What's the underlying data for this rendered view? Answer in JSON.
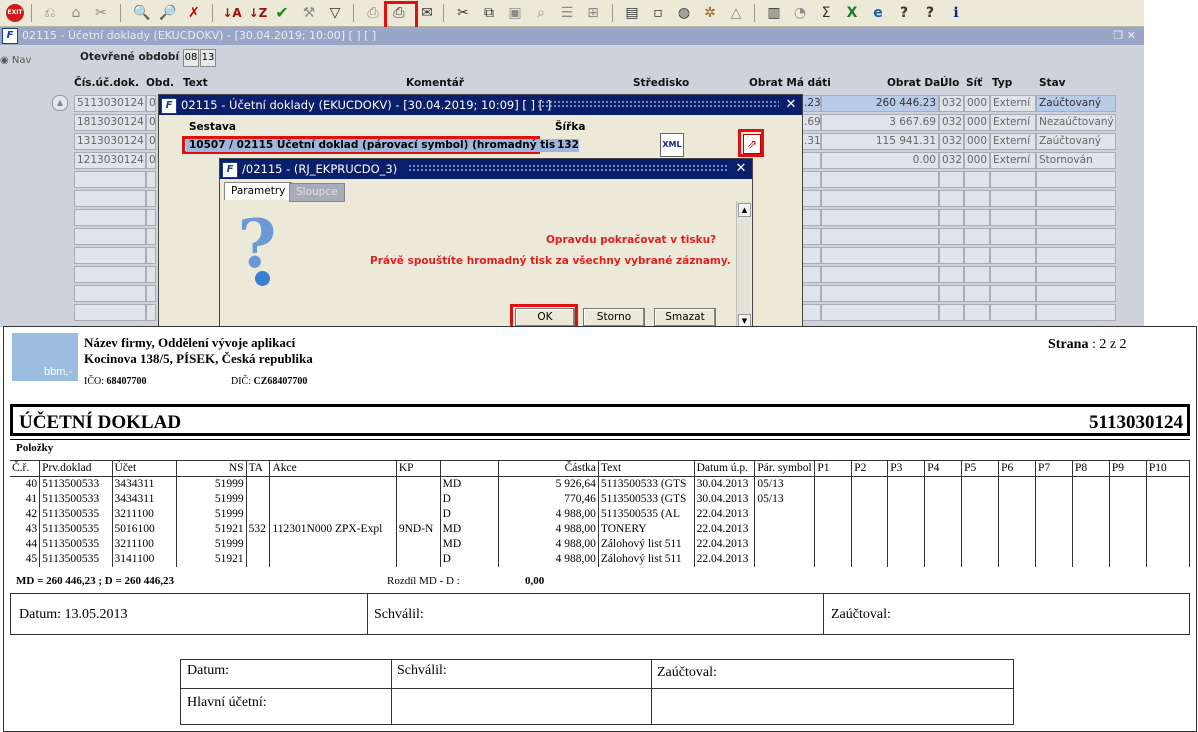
{
  "toolbar": {
    "exit_label": "EXIT",
    "icons": [
      "exit-icon",
      "filter-add-icon",
      "home-icon",
      "tools-icon",
      "tools-x-icon",
      "search-doc-icon",
      "search-doc2-icon",
      "delete-doc-icon",
      "sort-asc-icon",
      "sort-desc-icon",
      "check-icon",
      "wrench-icon",
      "filter-icon",
      "print-icon",
      "print-batch-icon",
      "mail-icon",
      "cut-icon",
      "copy-icon",
      "paste-icon",
      "find-icon",
      "list-icon",
      "tree-icon",
      "export-icon",
      "save-icon",
      "globe-icon",
      "gear-icon",
      "warning-icon",
      "chart-icon",
      "clock-icon",
      "sum-icon",
      "excel-icon",
      "ie-icon",
      "help-icon",
      "help2-icon",
      "info-icon"
    ]
  },
  "main_window": {
    "title": "02115 - Účetní doklady (EKUCDOKV) - [30.04.2019; 10:00]  [ ] [ ]",
    "nav_label": "Nav",
    "period_label": "Otevřené období",
    "period_values": [
      "08",
      "13"
    ],
    "columns": {
      "doc": "Čís.úč.dok.",
      "period": "Obd.",
      "text": "Text",
      "comment": "Komentář",
      "center": "Středisko",
      "turnover_md": "Obrat Má dáti",
      "turnover_d": "Obrat Dal",
      "ulo": "Úlo",
      "net": "Síť",
      "type": "Typ",
      "status": "Stav"
    },
    "rows": [
      {
        "doc": "5113030124",
        "obd": "0",
        "md": ".23",
        "dal": "260 446.23",
        "ulo": "032",
        "sit": "000",
        "typ": "Externí",
        "stav": "Zaúčtovaný"
      },
      {
        "doc": "1813030124",
        "obd": "0",
        "md": ".69",
        "dal": "3 667.69",
        "ulo": "032",
        "sit": "000",
        "typ": "Externí",
        "stav": "Nezaúčtovaný"
      },
      {
        "doc": "1313030124",
        "obd": "0",
        "md": ".31",
        "dal": "115 941.31",
        "ulo": "032",
        "sit": "000",
        "typ": "Externí",
        "stav": "Zaúčtovaný"
      },
      {
        "doc": "1213030124",
        "obd": "0",
        "md": "",
        "dal": "0.00",
        "ulo": "032",
        "sit": "000",
        "typ": "Externí",
        "stav": "Stornován"
      }
    ]
  },
  "dialog1": {
    "title": "02115 - Účetní doklady (EKUCDOKV) - [30.04.2019; 10:09]  [ ] [ ]",
    "report_set_label": "Sestava",
    "report_set_value": "10507 / 02115  Účetní doklad (párovací symbol) (hromadný tisk)",
    "width_label": "Šířka",
    "width_value": "132",
    "xml_label": "XML"
  },
  "dialog2": {
    "title": "/02115 - (RJ_EKPRUCDO_3)",
    "tab_params": "Parametry",
    "tab_columns": "Sloupce",
    "question": "Opravdu pokračovat v tisku?",
    "message": "Právě spouštíte hromadný tisk za všechny vybrané záznamy.",
    "ok_label": "OK",
    "cancel_label": "Storno",
    "delete_label": "Smazat"
  },
  "report": {
    "logo_text": "bbm,-",
    "company_line1": "Název firmy, Oddělení vývoje aplikací",
    "company_line2": "Kocinova 138/5, PÍSEK, Česká republika",
    "ico_label": "IČO:",
    "ico_value": "68407700",
    "dic_label": "DIČ:",
    "dic_value": "CZ68407700",
    "page_label": "Strana",
    "page_value": ":  2  z  2",
    "doc_title": "ÚČETNÍ DOKLAD",
    "doc_number": "5113030124",
    "items_label": "Položky",
    "columns": [
      "Č.ř.",
      "Prv.doklad",
      "Účet",
      "NS",
      "TA",
      "Akce",
      "KP",
      "",
      "Částka",
      "Text",
      "Datum ú.p.",
      "Pár. symbol",
      "P1",
      "P2",
      "P3",
      "P4",
      "P5",
      "P6",
      "P7",
      "P8",
      "P9",
      "P10"
    ],
    "rows": [
      [
        "40",
        "5113500533",
        "3434311",
        "51999",
        "",
        "",
        "",
        "MD",
        "5 926,64",
        "5113500533 (GTS",
        "30.04.2013",
        "05/13"
      ],
      [
        "41",
        "5113500533",
        "3434311",
        "51999",
        "",
        "",
        "",
        "D",
        "770,46",
        "5113500533 (GTS",
        "30.04.2013",
        "05/13"
      ],
      [
        "42",
        "5113500535",
        "3211100",
        "51999",
        "",
        "",
        "",
        "D",
        "4 988,00",
        "5113500535 (AL",
        "22.04.2013",
        ""
      ],
      [
        "43",
        "5113500535",
        "5016100",
        "51921",
        "532",
        "112301N000 ZPX-Expl",
        "9ND-N",
        "MD",
        "4 988,00",
        "TONERY",
        "22.04.2013",
        ""
      ],
      [
        "44",
        "5113500535",
        "3211100",
        "51999",
        "",
        "",
        "",
        "MD",
        "4 988,00",
        "Zálohový list 511",
        "22.04.2013",
        ""
      ],
      [
        "45",
        "5113500535",
        "3141100",
        "51921",
        "",
        "",
        "",
        "D",
        "4 988,00",
        "Zálohový list 511",
        "22.04.2013",
        ""
      ]
    ],
    "totals": "MD = 260 446,23  ;  D = 260 446,23",
    "diff_label": "Rozdíl MD - D  :",
    "diff_value": "0,00",
    "date_label": "Datum: 13.05.2013",
    "approved_label": "Schválil:",
    "posted_label": "Zaúčtoval:",
    "lower_date_label": "Datum:",
    "lower_approved_label": "Schválil:",
    "lower_posted_label": "Zaúčtoval:",
    "chief_accountant_label": "Hlavní účetní:"
  }
}
